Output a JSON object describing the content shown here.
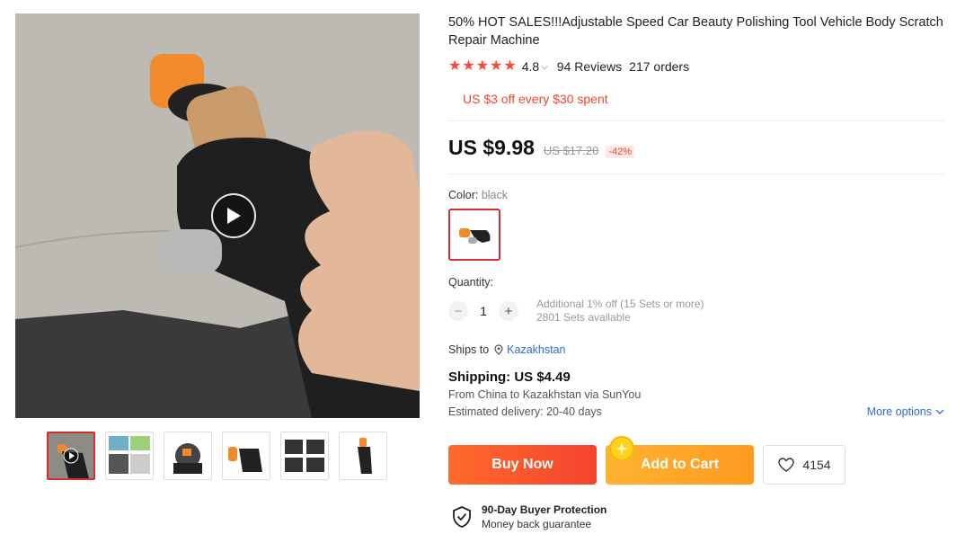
{
  "product": {
    "title": "50% HOT SALES!!!Adjustable Speed Car Beauty Polishing Tool Vehicle Body Scratch Repair Machine",
    "rating": "4.8",
    "reviews": "94 Reviews",
    "orders": "217 orders",
    "promo": "US $3 off every $30 spent",
    "price": "US $9.98",
    "old_price": "US $17.20",
    "discount": "-42%"
  },
  "variant": {
    "color_label": "Color:",
    "color_value": "black"
  },
  "quantity": {
    "label": "Quantity:",
    "value": "1",
    "note_line1": "Additional 1% off (15 Sets or more)",
    "note_line2": "2801 Sets available"
  },
  "shipping": {
    "ships_to_label": "Ships to",
    "destination": "Kazakhstan",
    "title": "Shipping: US $4.49",
    "from_prefix": "From ",
    "from_country": "China",
    "to_word": " to ",
    "to_country": "Kazakhstan",
    "via": " via SunYou",
    "delivery": "Estimated delivery: 20-40 days",
    "more_options": "More options"
  },
  "actions": {
    "buy_now": "Buy Now",
    "add_to_cart": "Add to Cart",
    "wishlist_count": "4154"
  },
  "protection": {
    "title": "90-Day Buyer Protection",
    "subtitle": "Money back guarantee"
  },
  "icons": {
    "star": "star-icon",
    "play": "play-icon",
    "pin": "location-pin-icon",
    "heart": "heart-icon",
    "shield": "shield-check-icon",
    "chevron": "chevron-down-icon"
  },
  "colors": {
    "accent_red": "#f4442e",
    "buy_gradient_start": "#ff6a2b",
    "cart_orange": "#ff9a1f",
    "link_blue": "#2e6bd6"
  }
}
